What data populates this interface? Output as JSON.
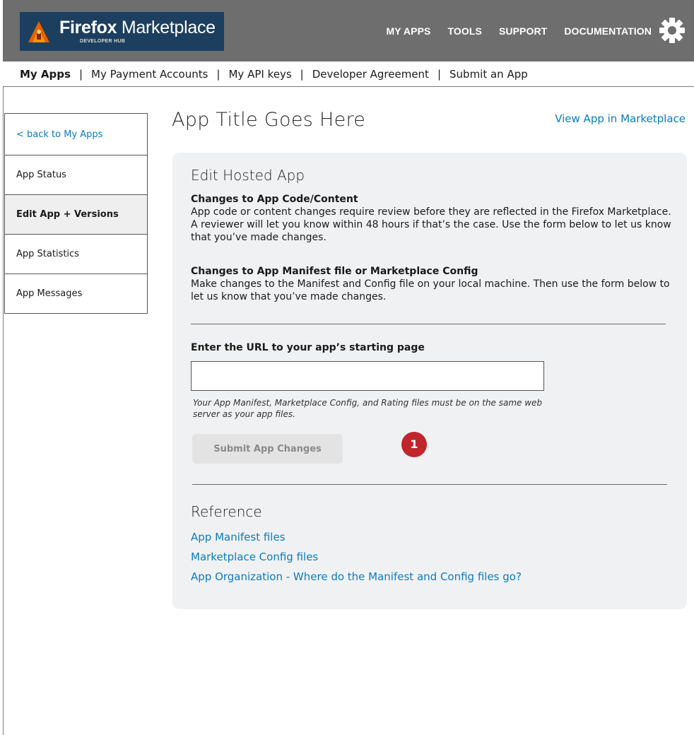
{
  "header": {
    "logo_title_bold": "Firefox",
    "logo_title_rest": " Marketplace",
    "logo_subtitle": "DEVELOPER HUB",
    "nav": [
      "MY APPS",
      "TOOLS",
      "SUPPORT",
      "DOCUMENTATION"
    ],
    "settings_icon": "gear-icon"
  },
  "subnav": {
    "items": [
      "My Apps",
      "My Payment Accounts",
      "My API keys",
      "Developer Agreement",
      "Submit an App"
    ],
    "separator": "|"
  },
  "sidebar": {
    "items": [
      "< back to My Apps",
      "App Status",
      "Edit App + Versions",
      "App Statistics",
      "App Messages"
    ]
  },
  "main": {
    "title": "App Title Goes Here",
    "view_link": "View App in Marketplace",
    "panel_title": "Edit Hosted App",
    "code_heading": "Changes to App Code/Content",
    "code_text": "App code or content changes require review before they are reflected in the Firefox Marketplace. A reviewer will let you know within 48 hours if that’s the case. Use the form below to let us know that you’ve made changes.",
    "manifest_heading": "Changes to App Manifest file or Marketplace Config",
    "manifest_text": "Make changes to the Manifest and Config file on your local machine. Then use the form below to let us know that you’ve made changes.",
    "url_label": "Enter the URL to your app’s starting page",
    "url_value": "",
    "hint": "Your App Manifest, Marketplace Config, and Rating files must be on the same web server as your app files.",
    "submit_label": "Submit App Changes",
    "badge": "1",
    "reference_title": "Reference",
    "reference_links": [
      "App Manifest files",
      "Marketplace Config files",
      "App Organization - Where do the Manifest and Config files go?"
    ]
  },
  "colors": {
    "header_bg": "#6e6e6e",
    "logo_bg": "#1c3f5f",
    "link": "#0a7cbf",
    "panel_bg": "#f0f1f3",
    "badge": "#c0262c"
  }
}
